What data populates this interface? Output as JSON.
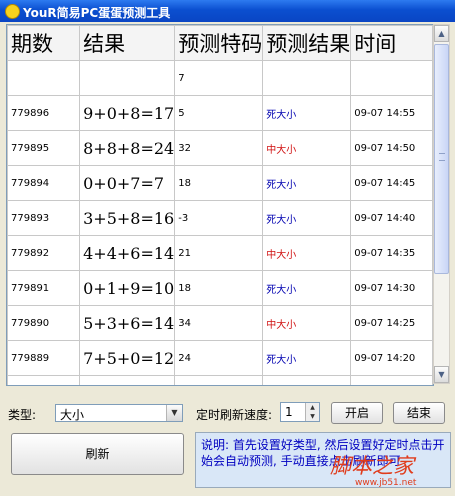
{
  "window": {
    "title": "YouR简易PC蛋蛋预测工具"
  },
  "grid": {
    "columns": [
      "期数",
      "结果",
      "预测特码",
      "预测结果",
      "时间"
    ],
    "rows": [
      {
        "period": "",
        "result": "",
        "code": "7",
        "prediction": "",
        "time": ""
      },
      {
        "period": "779896",
        "result": "9+0+8=17",
        "code": "5",
        "prediction": "死大小",
        "time": "09-07 14:55"
      },
      {
        "period": "779895",
        "result": "8+8+8=24",
        "code": "32",
        "prediction": "中大小",
        "time": "09-07 14:50"
      },
      {
        "period": "779894",
        "result": "0+0+7=7",
        "code": "18",
        "prediction": "死大小",
        "time": "09-07 14:45"
      },
      {
        "period": "779893",
        "result": "3+5+8=16",
        "code": "-3",
        "prediction": "死大小",
        "time": "09-07 14:40"
      },
      {
        "period": "779892",
        "result": "4+4+6=14",
        "code": "21",
        "prediction": "中大小",
        "time": "09-07 14:35"
      },
      {
        "period": "779891",
        "result": "0+1+9=10",
        "code": "18",
        "prediction": "死大小",
        "time": "09-07 14:30"
      },
      {
        "period": "779890",
        "result": "5+3+6=14",
        "code": "34",
        "prediction": "中大小",
        "time": "09-07 14:25"
      },
      {
        "period": "779889",
        "result": "7+5+0=12",
        "code": "24",
        "prediction": "死大小",
        "time": "09-07 14:20"
      },
      {
        "period": "",
        "result": "",
        "code": "",
        "prediction": "",
        "time": ""
      }
    ]
  },
  "controls": {
    "type_label": "类型:",
    "type_value": "大小",
    "refresh_speed_label": "定时刷新速度:",
    "refresh_speed_value": "1",
    "start_label": "开启",
    "stop_label": "结束",
    "refresh_label": "刷新"
  },
  "note": {
    "text": "说明: 首先设置好类型, 然后设置好定时点击开始会自动预测, 手动直接点击刷新即可"
  },
  "watermark": {
    "text": "脚本之家",
    "url": "www.jb51.net"
  },
  "colors": {
    "hit": "#d01010",
    "miss": "#0000b0",
    "titlebar": "#0b4fd0"
  }
}
